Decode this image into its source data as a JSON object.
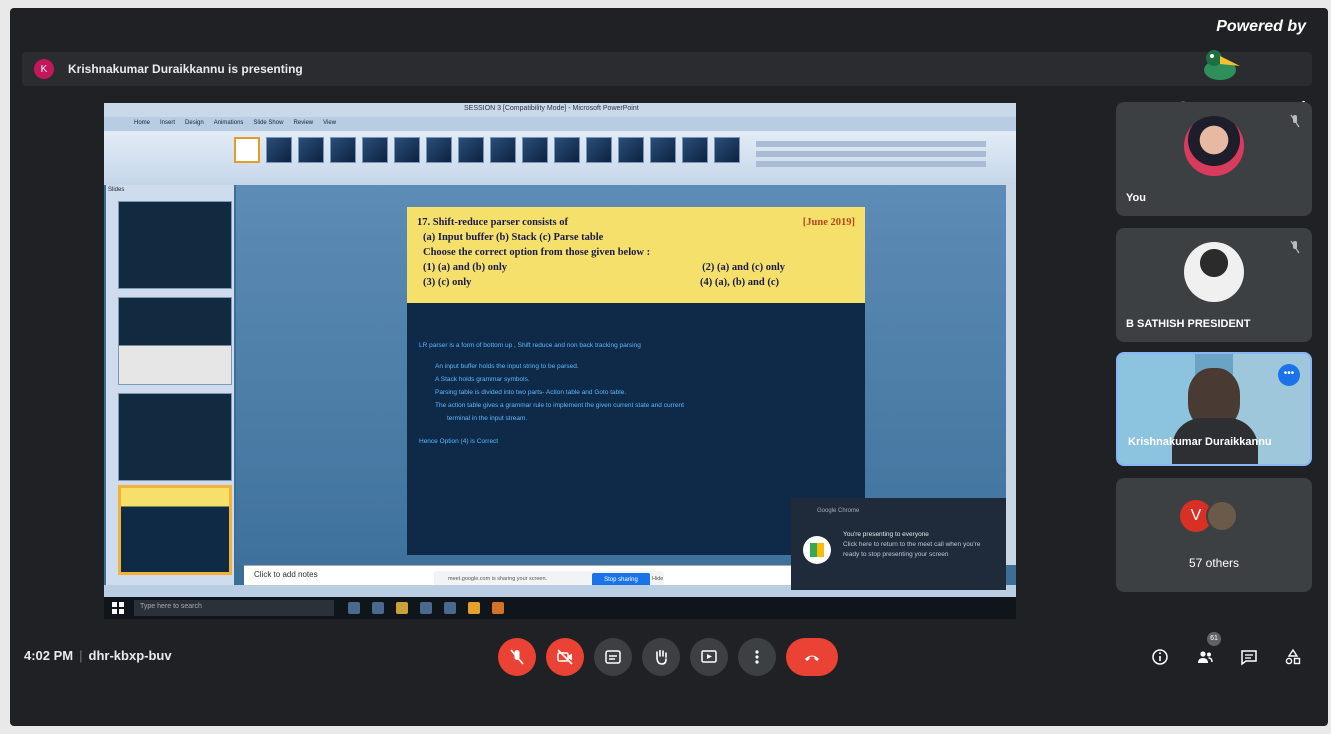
{
  "presenting_bar": {
    "avatar_letter": "K",
    "text": "Krishnakumar Duraikkannu is presenting"
  },
  "branding": {
    "powered_by": "Powered by",
    "name": "StreamYard"
  },
  "shared_screen": {
    "window_title": "SESSION 3 [Compatibility Mode] - Microsoft PowerPoint",
    "tabs": [
      "Home",
      "Insert",
      "Design",
      "Animations",
      "Slide Show",
      "Review",
      "View"
    ],
    "slides_tab": "Slides",
    "question": {
      "number_title": "17.  Shift-reduce parser consists of",
      "year": "[June 2019]",
      "parts": "(a) Input buffer (b) Stack (c) Parse table",
      "instruction": "Choose the correct option from those given below :",
      "option1": "(1) (a) and (b) only",
      "option2": "(2) (a) and (c) only",
      "option3": "(3) (c) only",
      "option4": "(4) (a), (b) and (c)"
    },
    "answer": {
      "line1": "LR parser is a form of bottom up , Shift reduce and non back tracking parsing",
      "bullet1": "An input buffer holds the input string to be parsed.",
      "bullet2": "A  Stack holds grammar symbols.",
      "bullet3": "Parsing table is divided into two parts- Action table and Goto table.",
      "bullet4a": "The action table gives a grammar rule to implement the given current state and current",
      "bullet4b": "terminal in the input stream.",
      "conclusion": "Hence Option (4) is Correct"
    },
    "notes_placeholder": "Click to add notes",
    "share_pill": {
      "text": "meet.google.com is sharing your screen.",
      "stop_label": "Stop sharing",
      "hide_label": "Hide"
    },
    "taskbar_search": "Type here to search",
    "toast": {
      "header": "Google Chrome",
      "title": "You're presenting to everyone",
      "body": "Click here to return to the meet call when you're ready to stop presenting your screen"
    }
  },
  "participants": [
    {
      "name": "You"
    },
    {
      "name": "B SATHISH PRESIDENT"
    },
    {
      "name": "Krishnakumar Duraikkannu"
    },
    {
      "name": "57 others",
      "avatar_letter": "V"
    }
  ],
  "bottom_bar": {
    "time": "4:02 PM",
    "meeting_code": "dhr-kbxp-buv",
    "participant_count": "61"
  },
  "colors": {
    "end_call": "#ea4335",
    "meet_bg": "#202124",
    "question_bg": "#f5e06b"
  }
}
